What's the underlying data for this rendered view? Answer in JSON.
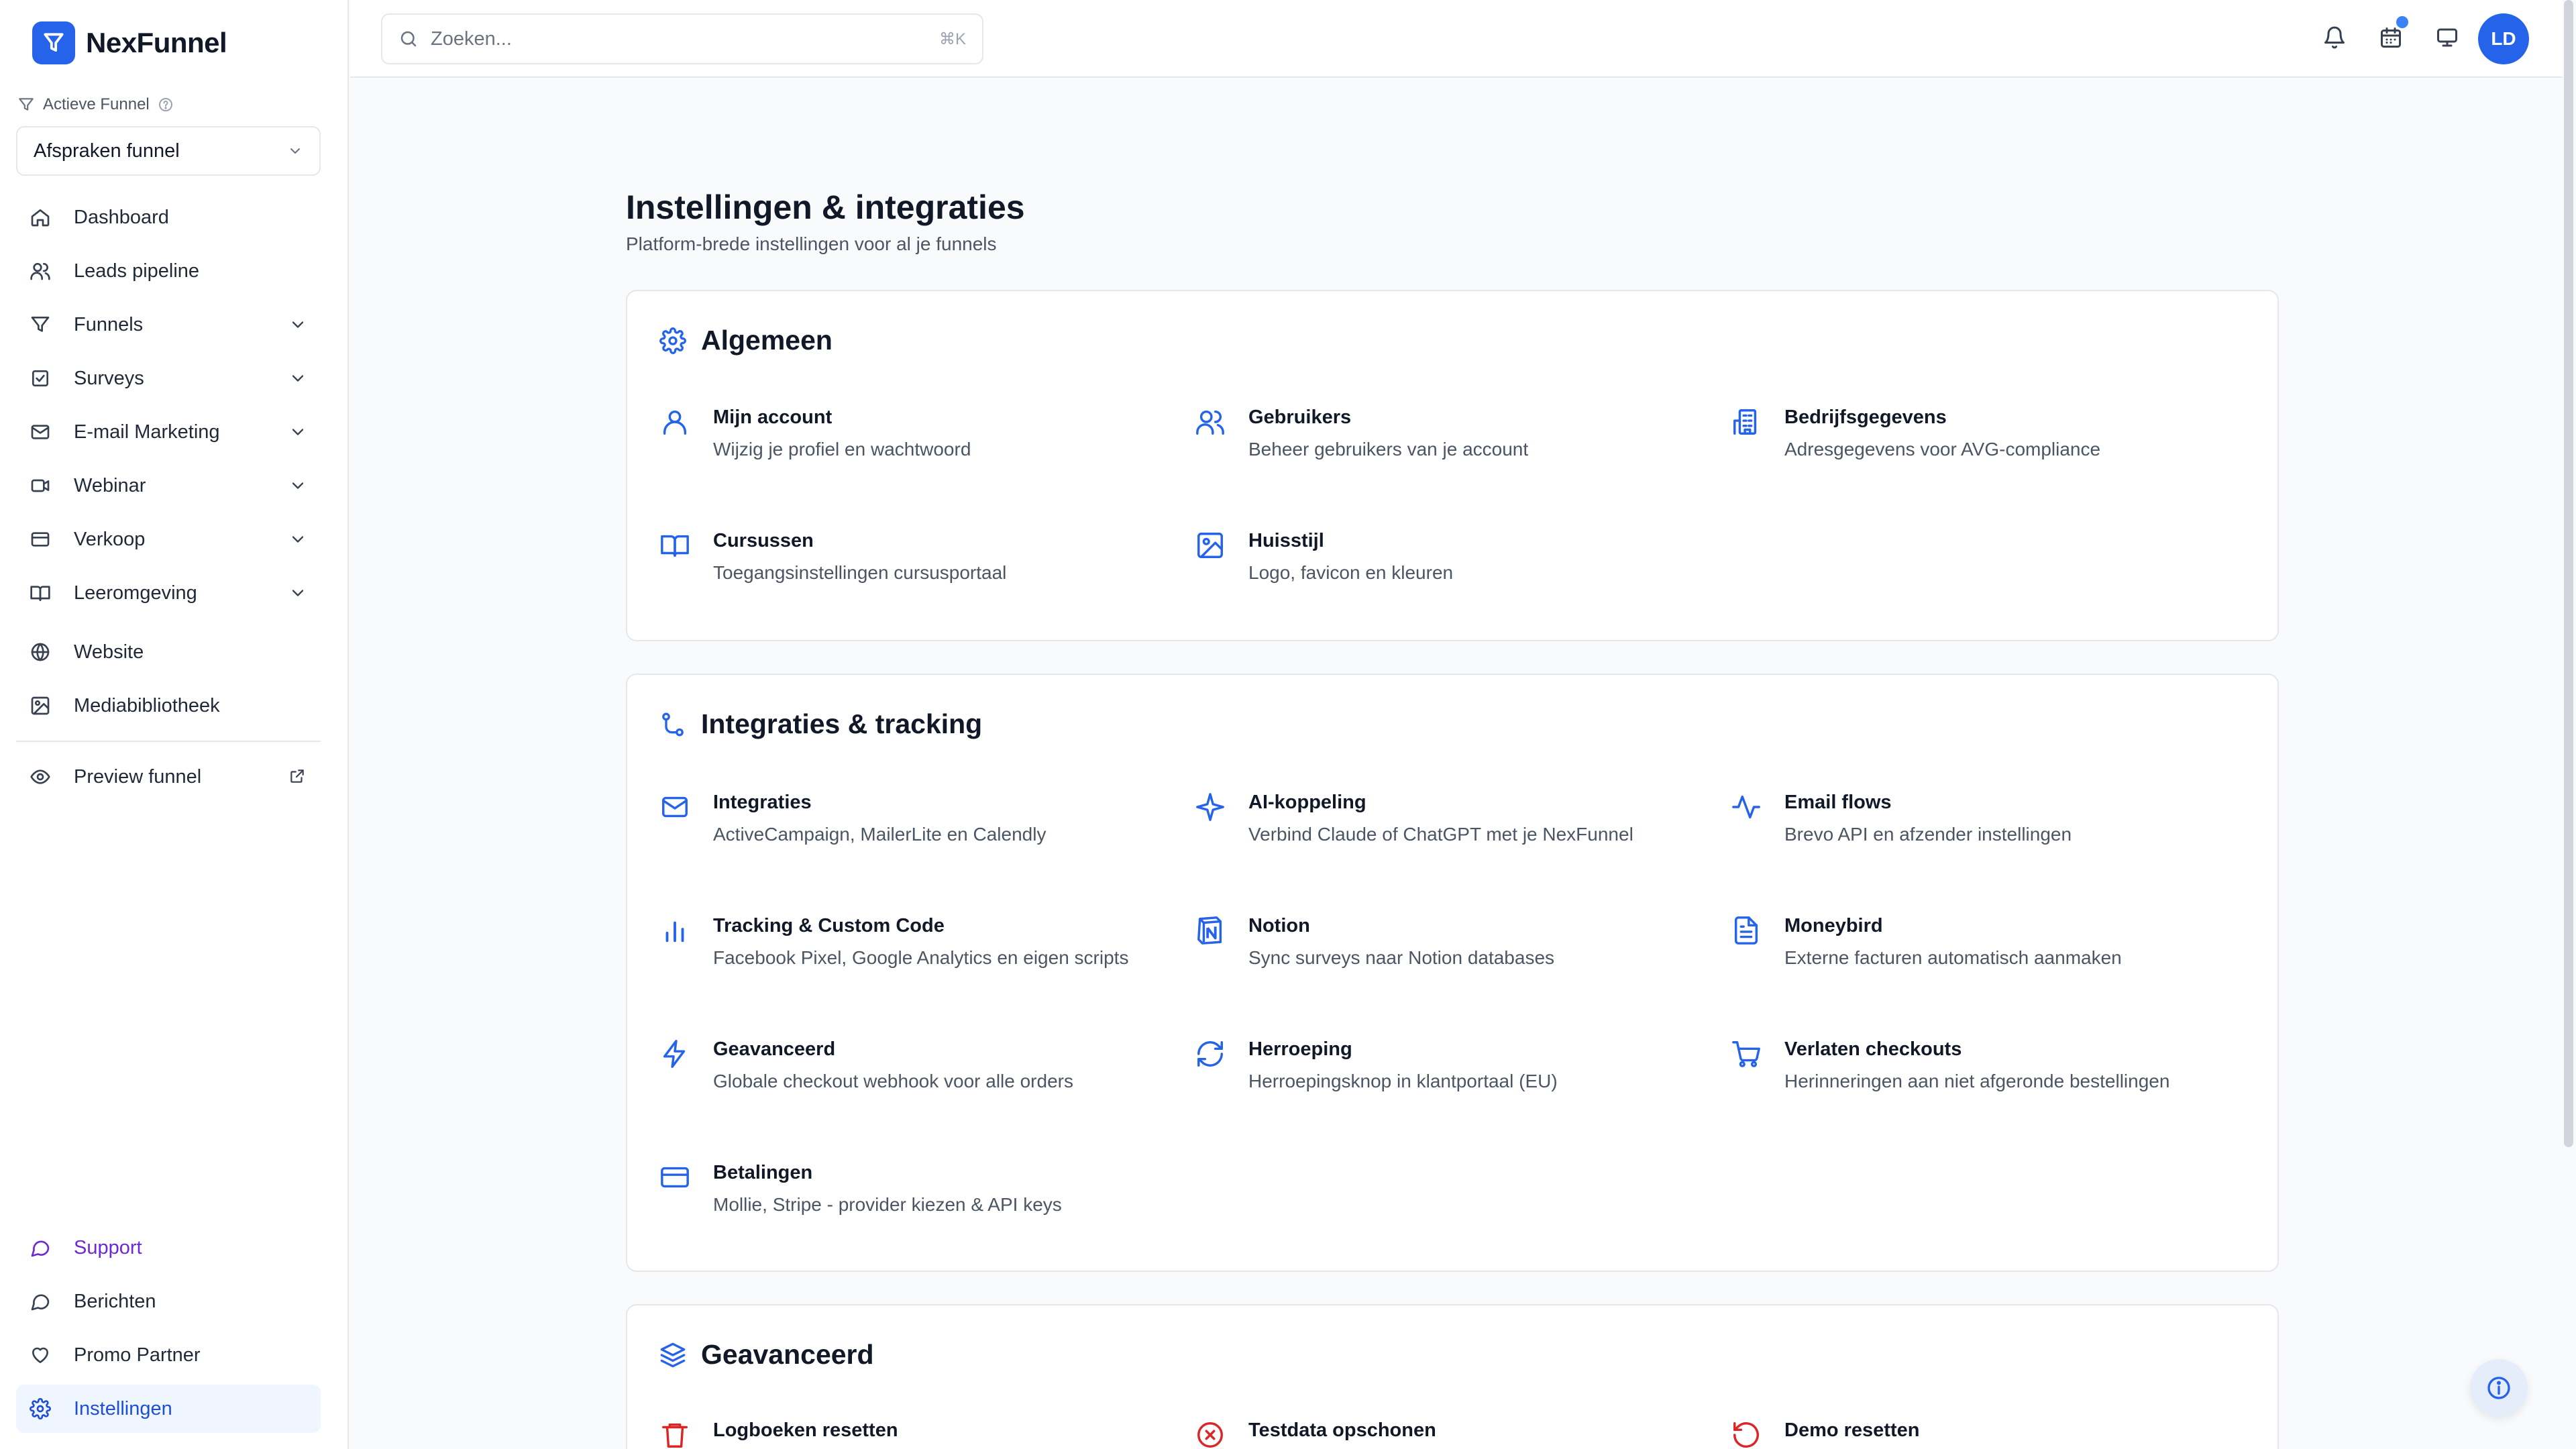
{
  "app": {
    "name": "NexFunnel"
  },
  "sidebar": {
    "active_funnel_label": "Actieve Funnel",
    "funnel_select_value": "Afspraken funnel",
    "nav": [
      {
        "label": "Dashboard",
        "icon": "home-icon"
      },
      {
        "label": "Leads pipeline",
        "icon": "users-icon"
      },
      {
        "label": "Funnels",
        "icon": "funnel-icon"
      },
      {
        "label": "Surveys",
        "icon": "checkbox-icon"
      },
      {
        "label": "E-mail Marketing",
        "icon": "mail-icon"
      },
      {
        "label": "Webinar",
        "icon": "video-icon"
      },
      {
        "label": "Verkoop",
        "icon": "card-icon"
      },
      {
        "label": "Leeromgeving",
        "icon": "book-icon"
      },
      {
        "label": "Website",
        "icon": "globe-icon"
      },
      {
        "label": "Mediabibliotheek",
        "icon": "image-icon"
      }
    ],
    "preview_label": "Preview funnel",
    "bottom": [
      {
        "label": "Support",
        "icon": "chat-icon"
      },
      {
        "label": "Berichten",
        "icon": "chat-icon"
      },
      {
        "label": "Promo Partner",
        "icon": "heart-icon"
      },
      {
        "label": "Instellingen",
        "icon": "gear-icon"
      }
    ]
  },
  "topbar": {
    "search_placeholder": "Zoeken...",
    "search_shortcut": "⌘K",
    "avatar_initials": "LD"
  },
  "page": {
    "title": "Instellingen & integraties",
    "subtitle": "Platform-brede instellingen voor al je funnels"
  },
  "sections": [
    {
      "title": "Algemeen",
      "items": [
        {
          "title": "Mijn account",
          "desc": "Wijzig je profiel en wachtwoord"
        },
        {
          "title": "Gebruikers",
          "desc": "Beheer gebruikers van je account"
        },
        {
          "title": "Bedrijfsgegevens",
          "desc": "Adresgegevens voor AVG-compliance"
        },
        {
          "title": "Cursussen",
          "desc": "Toegangsinstellingen cursusportaal"
        },
        {
          "title": "Huisstijl",
          "desc": "Logo, favicon en kleuren"
        }
      ]
    },
    {
      "title": "Integraties & tracking",
      "items": [
        {
          "title": "Integraties",
          "desc": "ActiveCampaign, MailerLite en Calendly"
        },
        {
          "title": "AI-koppeling",
          "desc": "Verbind Claude of ChatGPT met je NexFunnel"
        },
        {
          "title": "Email flows",
          "desc": "Brevo API en afzender instellingen"
        },
        {
          "title": "Tracking & Custom Code",
          "desc": "Facebook Pixel, Google Analytics en eigen scripts"
        },
        {
          "title": "Notion",
          "desc": "Sync surveys naar Notion databases"
        },
        {
          "title": "Moneybird",
          "desc": "Externe facturen automatisch aanmaken"
        },
        {
          "title": "Geavanceerd",
          "desc": "Globale checkout webhook voor alle orders"
        },
        {
          "title": "Herroeping",
          "desc": "Herroepingsknop in klantportaal (EU)"
        },
        {
          "title": "Verlaten checkouts",
          "desc": "Herinneringen aan niet afgeronde bestellingen"
        },
        {
          "title": "Betalingen",
          "desc": "Mollie, Stripe - provider kiezen & API keys"
        }
      ]
    },
    {
      "title": "Geavanceerd",
      "items": [
        {
          "title": "Logboeken resetten"
        },
        {
          "title": "Testdata opschonen"
        },
        {
          "title": "Demo resetten"
        }
      ]
    }
  ],
  "colors": {
    "accent": "#2563eb",
    "danger": "#dc2626",
    "support": "#6d28d9"
  }
}
